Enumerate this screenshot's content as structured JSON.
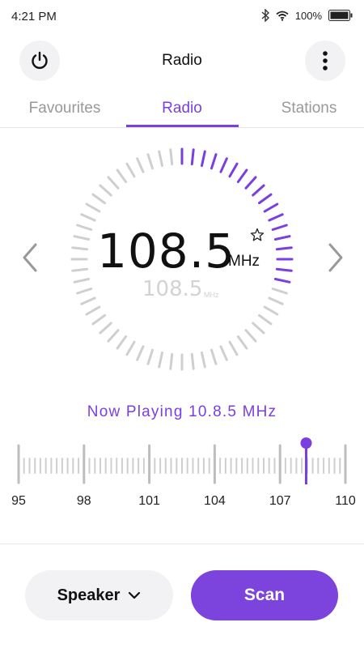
{
  "status_bar": {
    "time": "4:21 PM",
    "battery_text": "100%",
    "icons": [
      "bluetooth-icon",
      "wifi-icon",
      "battery-icon"
    ]
  },
  "header": {
    "title": "Radio",
    "left_icon": "power-icon",
    "right_icon": "more-vertical-icon"
  },
  "tabs": [
    {
      "label": "Favourites",
      "active": false
    },
    {
      "label": "Radio",
      "active": true
    },
    {
      "label": "Stations",
      "active": false
    }
  ],
  "display": {
    "frequency": "108.5",
    "unit": "MHz",
    "frequency_shadow": "108.5",
    "unit_shadow": "MHz",
    "favourite_icon": "star-outline-icon",
    "prev_icon": "chevron-left-icon",
    "next_icon": "chevron-right-icon",
    "dial_fill_fraction": 0.3
  },
  "now_playing": "Now Playing 10.8.5 MHz",
  "tuner": {
    "scale_labels": [
      "95",
      "98",
      "101",
      "104",
      "107",
      "110"
    ],
    "min": 95,
    "max": 110,
    "current": 108.2
  },
  "bottom": {
    "speaker_label": "Speaker",
    "speaker_icon": "chevron-down-icon",
    "scan_label": "Scan"
  },
  "colors": {
    "accent": "#7b3fe0",
    "inactive": "#999999",
    "tick_gray": "#cfcfcf"
  }
}
